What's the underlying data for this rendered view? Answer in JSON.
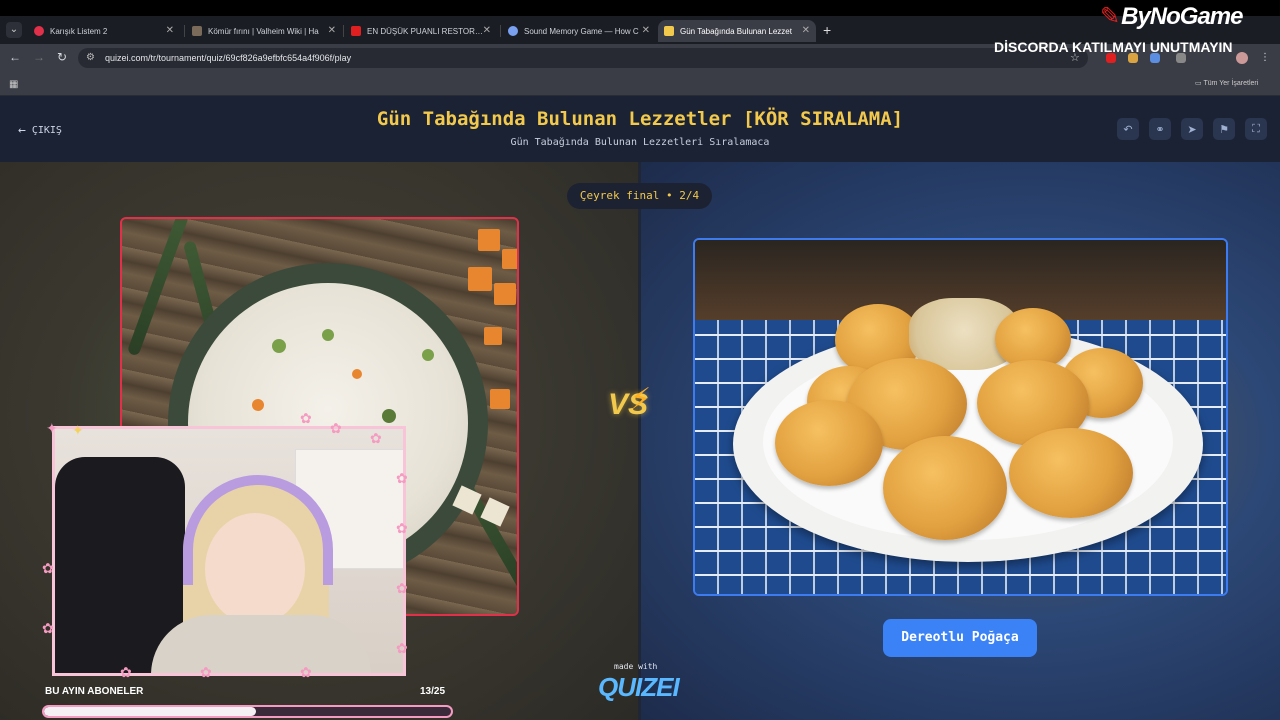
{
  "browser": {
    "tabs": [
      {
        "label": "Karışık Listem 2",
        "favicon_color": "#e0304a"
      },
      {
        "label": "Kömür fırını | Valheim Wiki | Ha",
        "favicon_color": "#7a6a5a"
      },
      {
        "label": "EN DÜŞÜK PUANLI RESTORANI",
        "favicon_color": "#e02020"
      },
      {
        "label": "Sound Memory Game — How C",
        "favicon_color": "#7aa0f0"
      },
      {
        "label": "Gün Tabağında Bulunan Lezzet",
        "favicon_color": "#f2c94c"
      }
    ],
    "url": "quizei.com/tr/tournament/quiz/69cf826a9efbfc654a4f906f/play",
    "bookmarks_folder": "Tüm Yer İşaretleri"
  },
  "overlay": {
    "logo": "ByNoGame",
    "discord_note": "DİSCORDA KATILMAYI UNUTMAYIN",
    "subscribers_label": "BU AYIN ABONELER",
    "subscribers_count": "13/25",
    "subscribers_progress": 0.52
  },
  "quiz": {
    "exit_label": "ÇIKIŞ",
    "title": "Gün Tabağında Bulunan Lezzetler [KÖR SIRALAMA]",
    "subtitle": "Gün Tabağında Bulunan Lezzetleri Sıralamaca",
    "round": "Çeyrek final • 2/4",
    "vs": "VS",
    "right_choice_label": "Dereotlu Poğaça",
    "made_with": "made with",
    "brand": "QUIZEI"
  },
  "colors": {
    "accent_gold": "#f2c94c",
    "left_border": "#e0304a",
    "right_border": "#3d7bf0",
    "button_blue": "#3b82f6"
  }
}
